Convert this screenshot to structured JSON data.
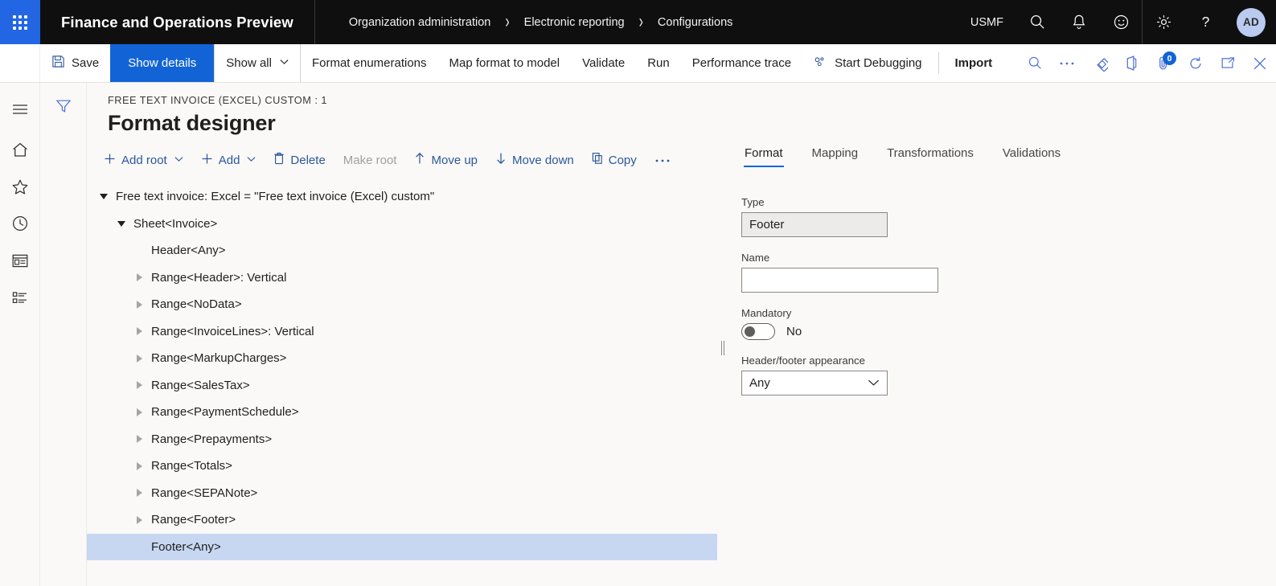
{
  "topnav": {
    "app_title": "Finance and Operations Preview",
    "breadcrumb": [
      "Organization administration",
      "Electronic reporting",
      "Configurations"
    ],
    "breadcrumb_separator": "›",
    "company": "USMF",
    "icons": [
      "search-icon",
      "bell-icon",
      "smiley-icon",
      "gear-icon",
      "help-icon"
    ],
    "avatar_initials": "AD",
    "waffle": "app-launcher-icon",
    "accent_blue": "#2266e3",
    "bar_bg": "#0f0f0f"
  },
  "commandbar": {
    "save_label": "Save",
    "show_details_label": "Show details",
    "show_all_label": "Show all",
    "format_enumerations_label": "Format enumerations",
    "map_format_to_model_label": "Map format to model",
    "validate_label": "Validate",
    "run_label": "Run",
    "performance_trace_label": "Performance trace",
    "start_debugging_label": "Start Debugging",
    "import_label": "Import",
    "caret": "⌄",
    "attachment_badge": "0",
    "primary_bg": "#1264d6"
  },
  "rail": {
    "items": [
      "hamburger-icon",
      "home-icon",
      "favorites-star-icon",
      "recent-clock-icon",
      "workspaces-icon",
      "modules-icon"
    ]
  },
  "page": {
    "filter_icon": "filter-icon",
    "eyebrow": "FREE TEXT INVOICE (EXCEL) CUSTOM : 1",
    "title": "Format designer"
  },
  "tree_toolbar": {
    "add_root_label": "Add root",
    "add_label": "Add",
    "delete_label": "Delete",
    "make_root_label": "Make root",
    "move_up_label": "Move up",
    "move_down_label": "Move down",
    "copy_label": "Copy",
    "overflow_label": "⋯",
    "caret": "⌄"
  },
  "tree": {
    "rows": [
      {
        "label": "Free text invoice: Excel = \"Free text invoice (Excel) custom\"",
        "indent": 0,
        "state": "open",
        "selected": false
      },
      {
        "label": "Sheet<Invoice>",
        "indent": 1,
        "state": "open",
        "selected": false
      },
      {
        "label": "Header<Any>",
        "indent": 2,
        "state": "leaf",
        "selected": false
      },
      {
        "label": "Range<Header>: Vertical",
        "indent": 2,
        "state": "collapsed",
        "selected": false
      },
      {
        "label": "Range<NoData>",
        "indent": 2,
        "state": "collapsed",
        "selected": false
      },
      {
        "label": "Range<InvoiceLines>: Vertical",
        "indent": 2,
        "state": "collapsed",
        "selected": false
      },
      {
        "label": "Range<MarkupCharges>",
        "indent": 2,
        "state": "collapsed",
        "selected": false
      },
      {
        "label": "Range<SalesTax>",
        "indent": 2,
        "state": "collapsed",
        "selected": false
      },
      {
        "label": "Range<PaymentSchedule>",
        "indent": 2,
        "state": "collapsed",
        "selected": false
      },
      {
        "label": "Range<Prepayments>",
        "indent": 2,
        "state": "collapsed",
        "selected": false
      },
      {
        "label": "Range<Totals>",
        "indent": 2,
        "state": "collapsed",
        "selected": false
      },
      {
        "label": "Range<SEPANote>",
        "indent": 2,
        "state": "collapsed",
        "selected": false
      },
      {
        "label": "Range<Footer>",
        "indent": 2,
        "state": "collapsed",
        "selected": false
      },
      {
        "label": "Footer<Any>",
        "indent": 2,
        "state": "leaf",
        "selected": true
      }
    ],
    "selected_row_bg": "#c7d7f2"
  },
  "details": {
    "tabs": [
      {
        "label": "Format",
        "active": true
      },
      {
        "label": "Mapping",
        "active": false
      },
      {
        "label": "Transformations",
        "active": false
      },
      {
        "label": "Validations",
        "active": false
      }
    ],
    "type_label": "Type",
    "type_value": "Footer",
    "name_label": "Name",
    "name_value": "",
    "name_placeholder": "",
    "mandatory_label": "Mandatory",
    "mandatory_value": "No",
    "mandatory_on": false,
    "appearance_label": "Header/footer appearance",
    "appearance_value": "Any",
    "appearance_caret": "⌄",
    "active_tab_underline": "#1264d6"
  }
}
